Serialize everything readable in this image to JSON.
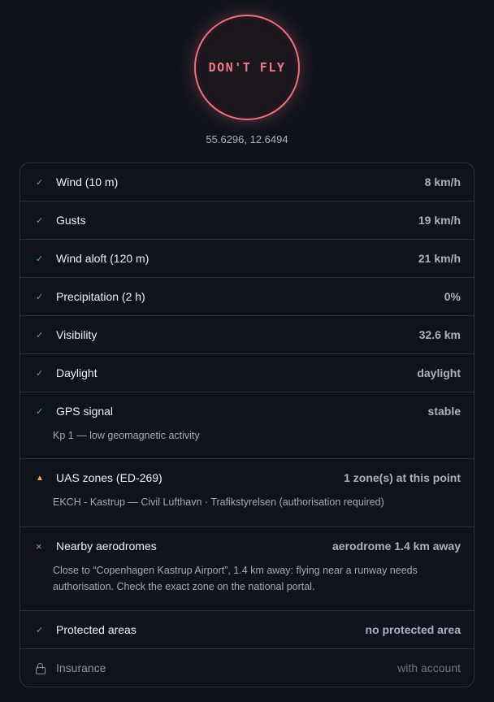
{
  "verdict": {
    "label": "DON'T FLY"
  },
  "location": {
    "coords": "55.6296, 12.6494"
  },
  "checks": [
    {
      "status": "ok",
      "icon": "check-icon",
      "label": "Wind (10 m)",
      "value": "8 km/h"
    },
    {
      "status": "ok",
      "icon": "check-icon",
      "label": "Gusts",
      "value": "19 km/h"
    },
    {
      "status": "ok",
      "icon": "check-icon",
      "label": "Wind aloft (120 m)",
      "value": "21 km/h"
    },
    {
      "status": "ok",
      "icon": "check-icon",
      "label": "Precipitation (2 h)",
      "value": "0%"
    },
    {
      "status": "ok",
      "icon": "check-icon",
      "label": "Visibility",
      "value": "32.6 km"
    },
    {
      "status": "ok",
      "icon": "check-icon",
      "label": "Daylight",
      "value": "daylight"
    },
    {
      "status": "ok",
      "icon": "check-icon",
      "label": "GPS signal",
      "value": "stable",
      "note": "Kp 1 — low geomagnetic activity"
    },
    {
      "status": "warn",
      "icon": "warning-triangle-icon",
      "label": "UAS zones (ED-269)",
      "value": "1 zone(s) at this point",
      "note": "EKCH - Kastrup — Civil Lufthavn · Trafikstyrelsen (authorisation required)"
    },
    {
      "status": "bad",
      "icon": "cross-icon",
      "label": "Nearby aerodromes",
      "value": "aerodrome 1.4 km away",
      "note": "Close to “Copenhagen Kastrup Airport”, 1.4 km away: flying near a runway needs authorisation. Check the exact zone on the national portal."
    },
    {
      "status": "ok",
      "icon": "check-icon",
      "label": "Protected areas",
      "value": "no protected area"
    },
    {
      "status": "locked",
      "icon": "lock-icon",
      "label": "Insurance",
      "value": "with account"
    }
  ],
  "symbols": {
    "ok": "✓",
    "warn": "▲",
    "bad": "×"
  },
  "colors": {
    "ok": "#3fc18a",
    "warn": "#f2b33d",
    "bad": "#f07a86",
    "verdict": "#f07a86"
  }
}
